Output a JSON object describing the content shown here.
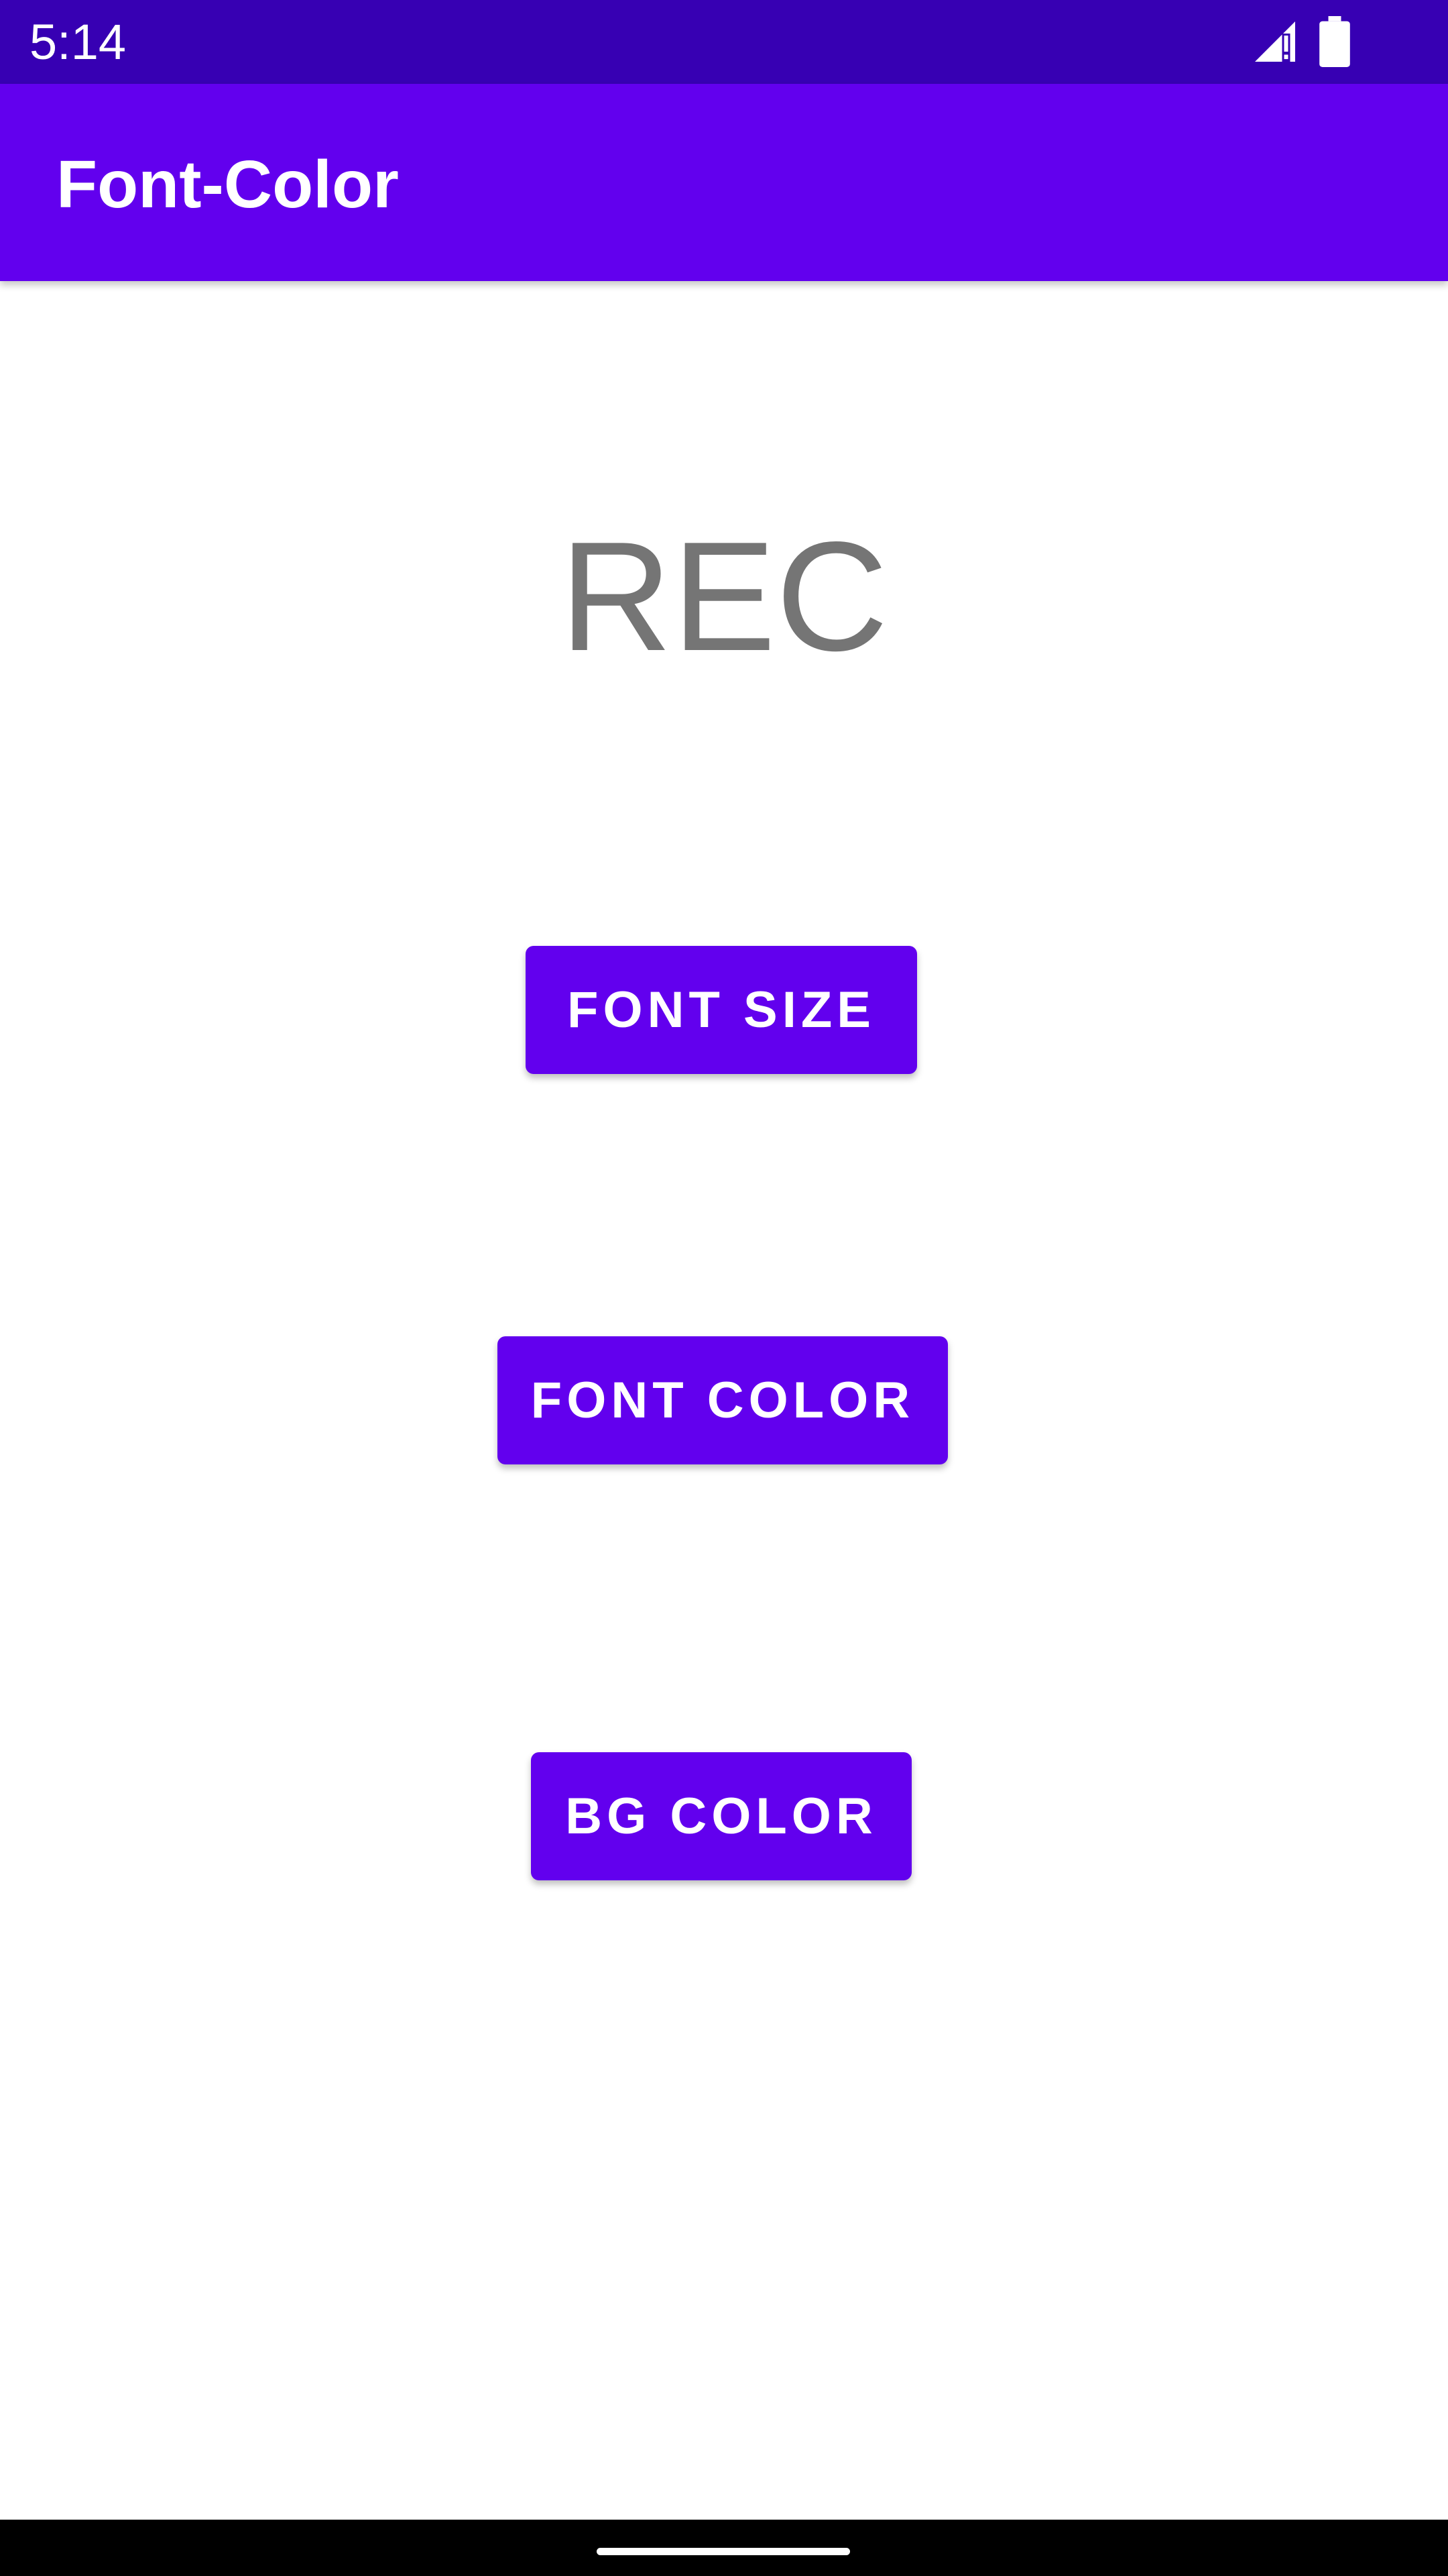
{
  "status_bar": {
    "time": "5:14",
    "icons": [
      "signal-icon",
      "battery-icon"
    ],
    "background": "#3700b3"
  },
  "app_bar": {
    "title": "Font-Color",
    "background": "#6200ee"
  },
  "main": {
    "preview_text": "REC",
    "preview_color": "#757575",
    "buttons": {
      "font_size": "FONT SIZE",
      "font_color": "FONT COLOR",
      "bg_color": "BG COLOR"
    },
    "button_color": "#6200ee"
  },
  "nav_bar": {
    "background": "#000000"
  }
}
